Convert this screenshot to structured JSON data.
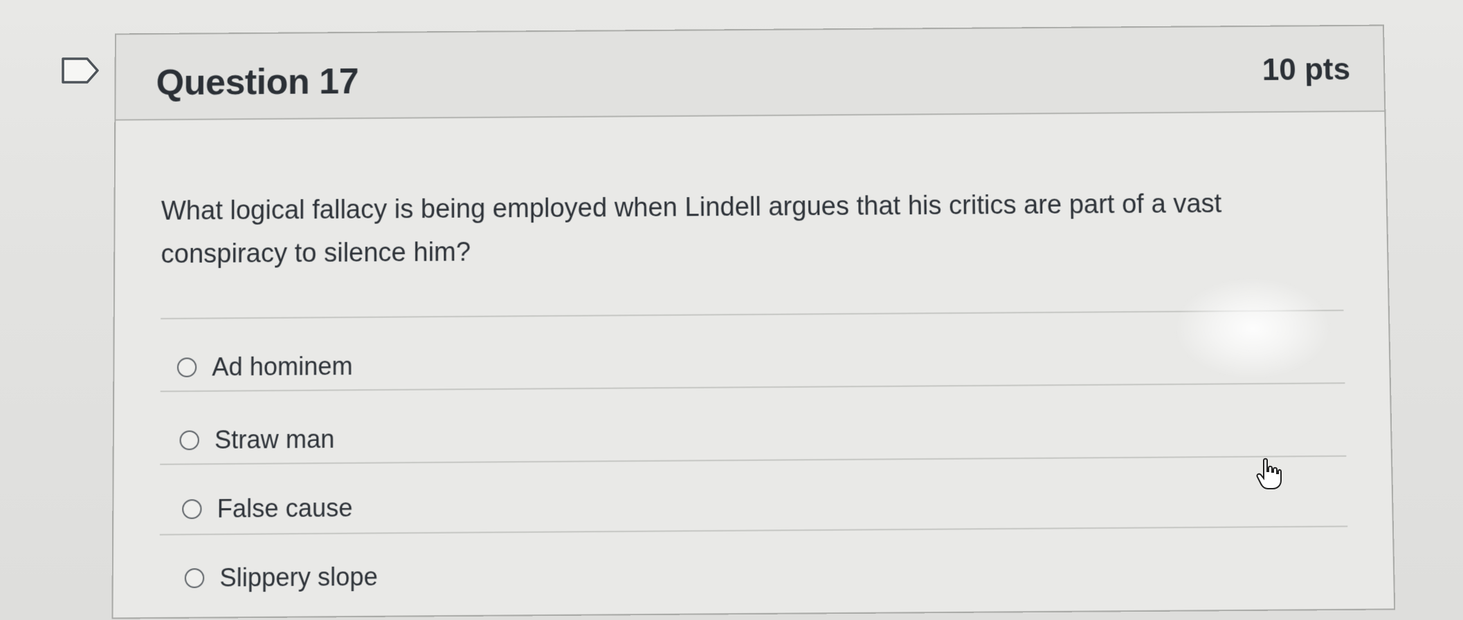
{
  "question": {
    "title": "Question 17",
    "points": "10 pts",
    "text": "What logical fallacy is being employed when Lindell argues that his critics are part of a vast conspiracy to silence him?"
  },
  "answers": [
    {
      "label": "Ad hominem",
      "selected": false
    },
    {
      "label": "Straw man",
      "selected": false
    },
    {
      "label": "False cause",
      "selected": false
    },
    {
      "label": "Slippery slope",
      "selected": false
    }
  ],
  "icons": {
    "bookmark": "bookmark-flag-icon",
    "cursor": "hand-pointer-cursor-icon",
    "radio": "radio-button-icon"
  },
  "colors": {
    "background": "#e5e5e3",
    "card": "#e9e9e7",
    "header": "#e1e1df",
    "border": "#a9aaa7",
    "text": "#2e3339"
  }
}
